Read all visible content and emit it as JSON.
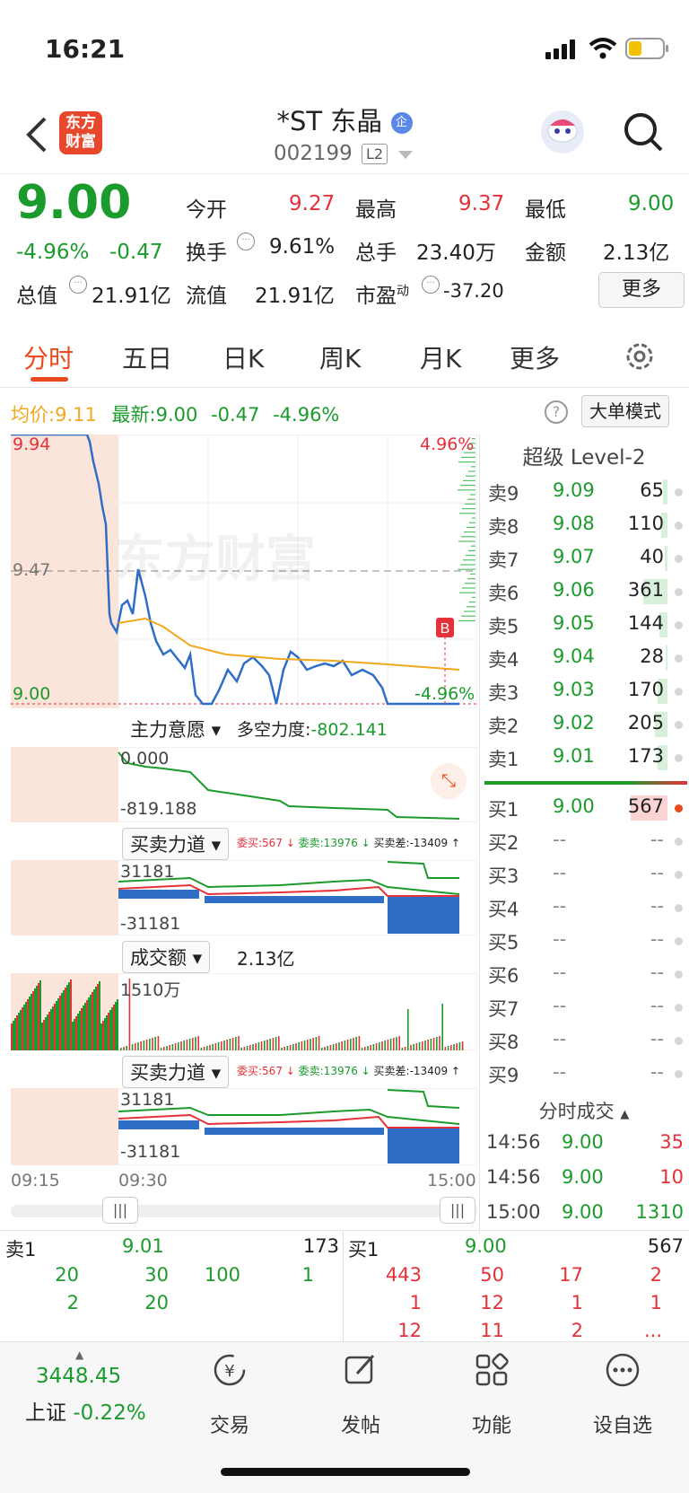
{
  "status": {
    "time": "16:21"
  },
  "header": {
    "back_label": "<",
    "logo_text_line1": "东方",
    "logo_text_line2": "财富",
    "title": "*ST 东晶",
    "corp_badge": "企",
    "code": "002199",
    "level_badge": "L2"
  },
  "quote": {
    "price": "9.00",
    "change_pct": "-4.96%",
    "change": "-0.47",
    "open_label": "今开",
    "open": "9.27",
    "high_label": "最高",
    "high": "9.37",
    "low_label": "最低",
    "low": "9.00",
    "turnover_label": "换手",
    "turnover": "9.61%",
    "volume_label": "总手",
    "volume": "23.40万",
    "amount_label": "金额",
    "amount": "2.13亿",
    "mcap_label": "总值",
    "mcap": "21.91亿",
    "float_label": "流值",
    "float_cap": "21.91亿",
    "pe_label": "市盈",
    "pe_sup": "动",
    "pe": "-37.20",
    "more_button": "更多"
  },
  "tabs": [
    "分时",
    "五日",
    "日K",
    "周K",
    "月K",
    "更多"
  ],
  "intraday": {
    "avg_label": "均价:",
    "avg": "9.11",
    "latest_label": "最新:",
    "latest": "9.00",
    "latest_chg": "-0.47",
    "latest_pct": "-4.96%",
    "big_order_mode": "大单模式",
    "y_top": "9.94",
    "y_mid": "9.47",
    "y_bottom": "9.00",
    "pct_top": "4.96%",
    "pct_bottom": "-4.96%",
    "watermark": "东方财富",
    "b_marker": "B",
    "time_start": "09:15",
    "time_open": "09:30",
    "time_end": "15:00"
  },
  "indicators": {
    "main_will_label": "主力意愿",
    "long_short_label": "多空力度:",
    "long_short_value": "-802.141",
    "main_will_top": "0.000",
    "main_will_bottom": "-819.188",
    "bs_force_label": "买卖力道",
    "bs_info_buy": "委买:567",
    "bs_info_sell": "委卖:13976",
    "bs_info_diff": "买卖差:-13409",
    "bs_top": "31181",
    "bs_bottom": "-31181",
    "amount_label": "成交额",
    "amount_value": "2.13亿",
    "amount_scale": "1510万",
    "bs_force_label2": "买卖力道",
    "bs2_top": "31181",
    "bs2_bottom": "-31181"
  },
  "orderbook": {
    "title": "超级 Level-2",
    "asks": [
      {
        "label": "卖9",
        "price": "9.09",
        "vol": "65",
        "bar": 0.05
      },
      {
        "label": "卖8",
        "price": "9.08",
        "vol": "110",
        "bar": 0.08
      },
      {
        "label": "卖7",
        "price": "9.07",
        "vol": "40",
        "bar": 0.03
      },
      {
        "label": "卖6",
        "price": "9.06",
        "vol": "361",
        "bar": 0.3
      },
      {
        "label": "卖5",
        "price": "9.05",
        "vol": "144",
        "bar": 0.1
      },
      {
        "label": "卖4",
        "price": "9.04",
        "vol": "28",
        "bar": 0.02
      },
      {
        "label": "卖3",
        "price": "9.03",
        "vol": "170",
        "bar": 0.12
      },
      {
        "label": "卖2",
        "price": "9.02",
        "vol": "205",
        "bar": 0.15
      },
      {
        "label": "卖1",
        "price": "9.01",
        "vol": "173",
        "bar": 0.12
      }
    ],
    "bids": [
      {
        "label": "买1",
        "price": "9.00",
        "vol": "567",
        "bar": 0.45
      },
      {
        "label": "买2",
        "price": "--",
        "vol": "--",
        "bar": 0
      },
      {
        "label": "买3",
        "price": "--",
        "vol": "--",
        "bar": 0
      },
      {
        "label": "买4",
        "price": "--",
        "vol": "--",
        "bar": 0
      },
      {
        "label": "买5",
        "price": "--",
        "vol": "--",
        "bar": 0
      },
      {
        "label": "买6",
        "price": "--",
        "vol": "--",
        "bar": 0
      },
      {
        "label": "买7",
        "price": "--",
        "vol": "--",
        "bar": 0
      },
      {
        "label": "买8",
        "price": "--",
        "vol": "--",
        "bar": 0
      },
      {
        "label": "买9",
        "price": "--",
        "vol": "--",
        "bar": 0
      }
    ],
    "ticks_title": "分时成交",
    "ticks": [
      {
        "time": "14:56",
        "price": "9.00",
        "vol": "35"
      },
      {
        "time": "14:56",
        "price": "9.00",
        "vol": "10"
      },
      {
        "time": "15:00",
        "price": "9.00",
        "vol": "1310"
      }
    ]
  },
  "queue": {
    "sell_label": "卖1",
    "sell_price": "9.01",
    "sell_total": "173",
    "buy_label": "买1",
    "buy_price": "9.00",
    "buy_total": "567",
    "sell_rows": [
      [
        "20",
        "30",
        "100",
        "1"
      ],
      [
        "2",
        "20",
        "",
        ""
      ]
    ],
    "buy_rows": [
      [
        "443",
        "50",
        "17",
        "2"
      ],
      [
        "1",
        "12",
        "1",
        "1"
      ],
      [
        "12",
        "11",
        "2",
        "..."
      ]
    ]
  },
  "bottom": {
    "index_value": "3448.45",
    "index_name": "上证",
    "index_pct": "-0.22%",
    "nav": [
      "交易",
      "发帖",
      "功能",
      "设自选"
    ]
  },
  "colors": {
    "up": "#e5313a",
    "down": "#1a9b2c",
    "brand": "#e84a1e",
    "price_line": "#2f6ec6",
    "avg_line": "#f2a81d"
  }
}
